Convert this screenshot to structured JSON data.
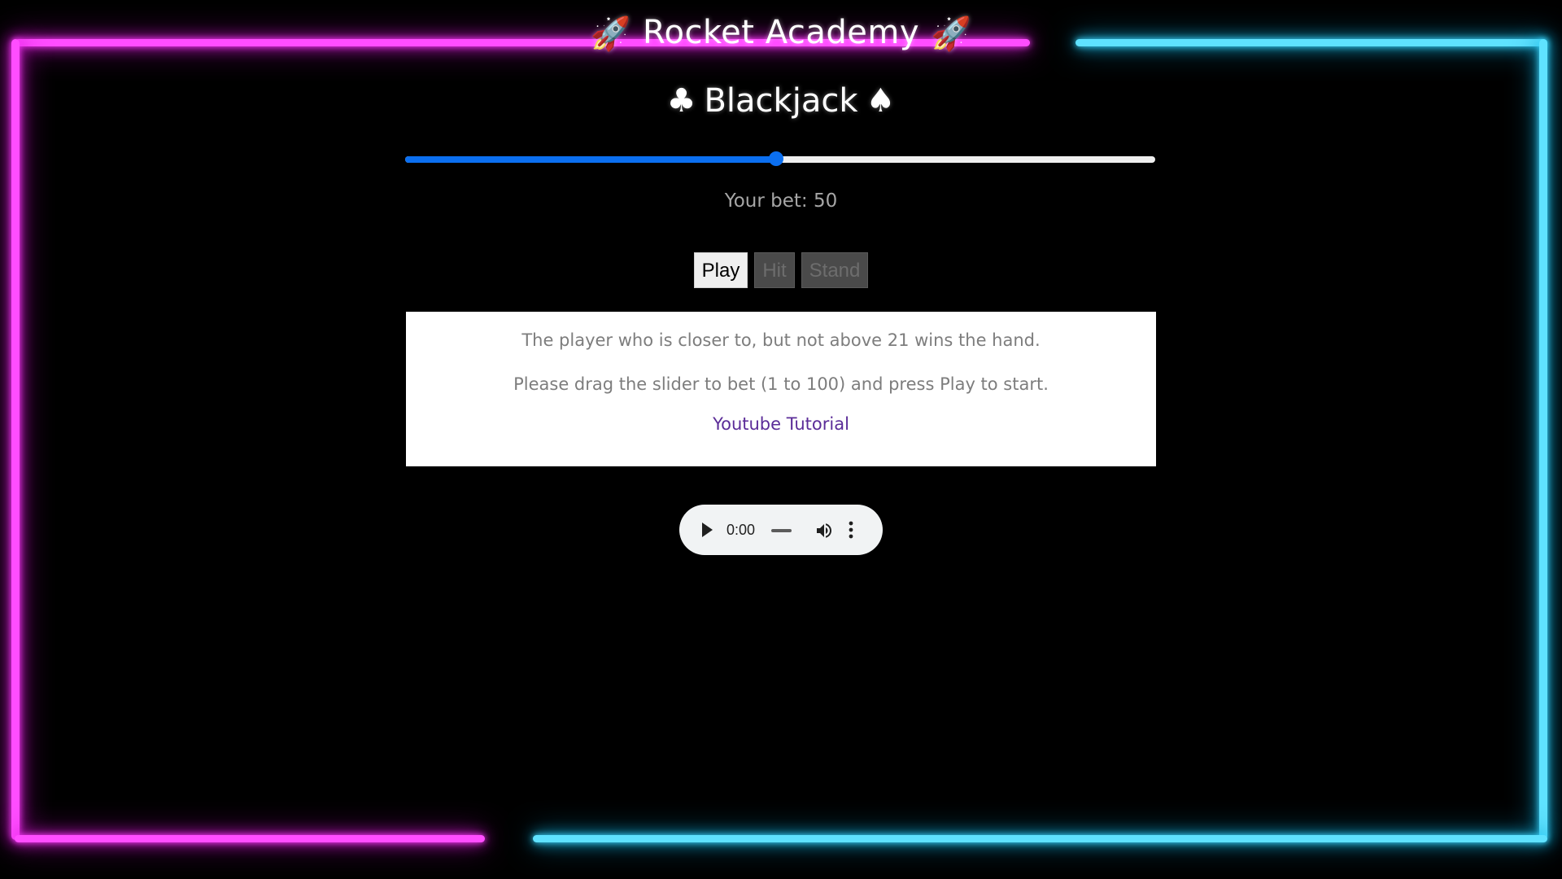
{
  "header": {
    "title": "Rocket Academy",
    "icon_left": "rocket-icon",
    "icon_right": "rocket-icon",
    "rocket_glyph": "🚀"
  },
  "game": {
    "title": "Blackjack",
    "suit_left": "♣",
    "suit_right": "♠"
  },
  "bet": {
    "min": 1,
    "max": 100,
    "value": 50,
    "label": "Your bet: 50",
    "accent_color": "#0b6ff0"
  },
  "buttons": {
    "play_label": "Play",
    "hit_label": "Hit",
    "stand_label": "Stand"
  },
  "info": {
    "line1": "The player who is closer to, but not above 21 wins the hand.",
    "line2": "Please drag the slider to bet (1 to 100) and press Play to start.",
    "link_text": "Youtube Tutorial"
  },
  "audio": {
    "time": "0:00",
    "play_icon": "play-icon",
    "volume_icon": "volume-icon",
    "more_icon": "more-vert-icon"
  },
  "frame": {
    "pink_color": "#ff4dff",
    "cyan_color": "#5fe2ff"
  }
}
